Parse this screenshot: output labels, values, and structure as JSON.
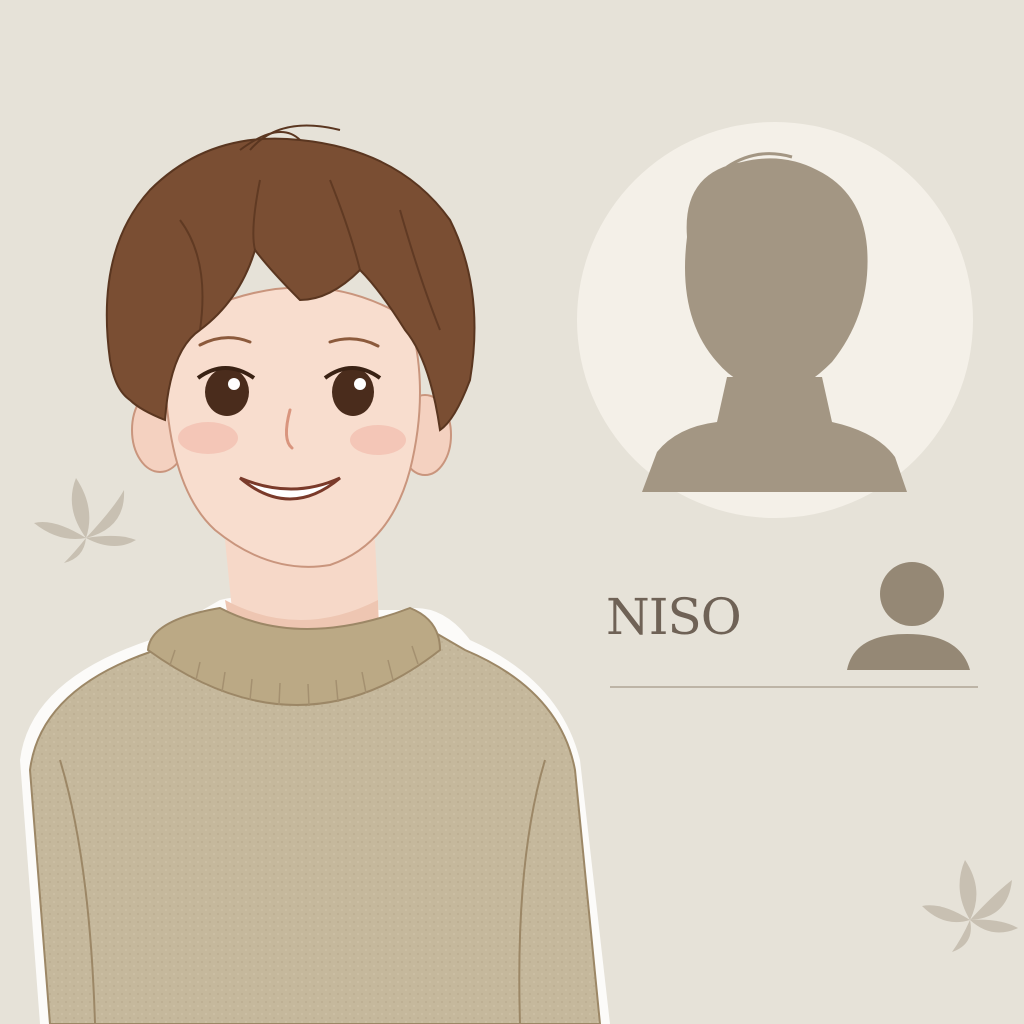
{
  "profile": {
    "name": "NISO"
  },
  "icons": {
    "placeholder_avatar": "person-silhouette-icon",
    "user": "user-icon",
    "leaf": "leaf-icon"
  },
  "colors": {
    "background": "#e6e2d8",
    "sweater": "#c4b69a",
    "hair": "#7a4e33",
    "silhouette": "#a39683",
    "name_text": "#6f6256"
  }
}
